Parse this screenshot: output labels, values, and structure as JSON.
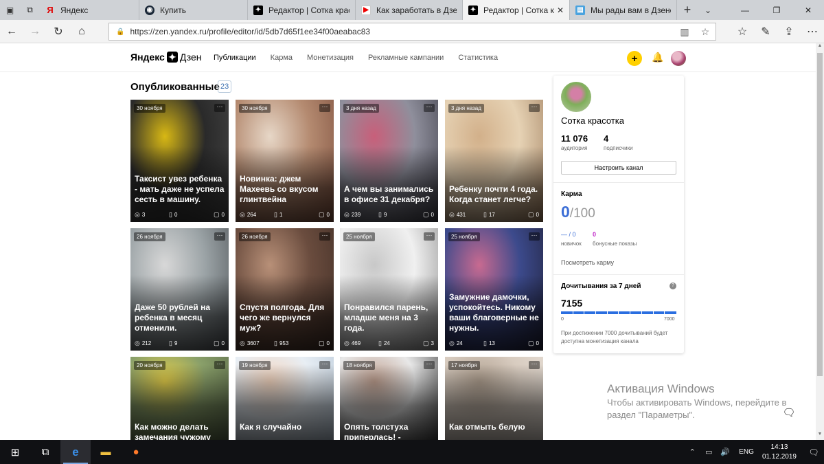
{
  "browser": {
    "tabs": [
      {
        "label": "Яндекс",
        "icon": "yandex-icon",
        "active": false
      },
      {
        "label": "Купить",
        "icon": "steam-icon",
        "active": false
      },
      {
        "label": "Редактор | Сотка красо",
        "icon": "zen-icon",
        "active": false
      },
      {
        "label": "Как заработать в Дзен",
        "icon": "video-icon",
        "active": false
      },
      {
        "label": "Редактор | Сотка к",
        "icon": "zen-icon",
        "active": true
      },
      {
        "label": "Мы рады вам в Дзене",
        "icon": "document-icon",
        "active": false
      }
    ],
    "url": "https://zen.yandex.ru/profile/editor/id/5db7d65f1ee34f00aeabac83"
  },
  "site": {
    "logo_text_1": "Яндекс",
    "logo_text_2": "Дзен",
    "nav": [
      "Публикации",
      "Карма",
      "Монетизация",
      "Рекламные кампании",
      "Статистика"
    ],
    "active_nav": "Публикации",
    "plus_label": "+"
  },
  "main": {
    "section_title": "Опубликованные",
    "count": "23",
    "cards": [
      {
        "date": "30 ноября",
        "title": "Таксист увез ребенка - мать даже не успела сесть в машину.",
        "views": "3",
        "reads": "0",
        "comments": "0",
        "colors": [
          "#2a2a2a",
          "#d8b814",
          "#4a4a4a"
        ]
      },
      {
        "date": "30 ноября",
        "title": "Новинка: джем Махеевь со вкусом глинтвейна",
        "views": "264",
        "reads": "1",
        "comments": "0",
        "colors": [
          "#b48a70",
          "#e7d7c7",
          "#7a4b3a"
        ]
      },
      {
        "date": "3 дня назад",
        "title": "А чем вы занимались в офисе 31 декабря?",
        "views": "239",
        "reads": "9",
        "comments": "0",
        "colors": [
          "#8f8f9c",
          "#c85f7a",
          "#3c3c46"
        ]
      },
      {
        "date": "3 дня назад",
        "title": "Ребенку почти 4 года. Когда станет легче?",
        "views": "431",
        "reads": "17",
        "comments": "0",
        "colors": [
          "#e6d2b4",
          "#d2b08a",
          "#9c7a5a"
        ]
      },
      {
        "date": "26 ноября",
        "title": "Даже 50 рублей на ребенка в месяц отменили.",
        "views": "212",
        "reads": "9",
        "comments": "0",
        "colors": [
          "#9ba3a6",
          "#d8d8d8",
          "#4b5054"
        ]
      },
      {
        "date": "26 ноября",
        "title": "Спустя полгода. Для чего же вернулся муж?",
        "views": "3607",
        "reads": "953",
        "comments": "0",
        "colors": [
          "#6a4c3e",
          "#b89078",
          "#3e2c24"
        ]
      },
      {
        "date": "25 ноября",
        "title": "Понравился парень, младше меня на 3 года.",
        "views": "469",
        "reads": "24",
        "comments": "3",
        "colors": [
          "#f0f0f0",
          "#c8c8c8",
          "#8a8a8a"
        ]
      },
      {
        "date": "25 ноября",
        "title": "Замужние дамочки, успокойтесь. Никому ваши благоверные не нужны.",
        "views": "24",
        "reads": "13",
        "comments": "0",
        "colors": [
          "#3c4a8c",
          "#c86a90",
          "#1e1e32"
        ]
      },
      {
        "date": "20 ноября",
        "title": "Как можно делать замечания чужому",
        "views": "",
        "reads": "",
        "comments": "",
        "colors": [
          "#8aa06a",
          "#e6d04a",
          "#5a6a4a"
        ]
      },
      {
        "date": "19 ноября",
        "title": "Как я случайно",
        "views": "",
        "reads": "",
        "comments": "",
        "colors": [
          "#e8eef4",
          "#f4d6c0",
          "#b8c8d8"
        ]
      },
      {
        "date": "18 ноября",
        "title": "Опять толстуха приперлась! - сказала",
        "views": "",
        "reads": "",
        "comments": "",
        "colors": [
          "#e8e8e8",
          "#c0a090",
          "#404040"
        ]
      },
      {
        "date": "17 ноября",
        "title": "Как отмыть белую",
        "views": "",
        "reads": "",
        "comments": "",
        "colors": [
          "#d8ccc0",
          "#b0a090",
          "#e8e0d8"
        ]
      }
    ]
  },
  "sidebar": {
    "channel_name": "Сотка красотка",
    "audience_value": "11 076",
    "audience_label": "аудитория",
    "subscribers_value": "4",
    "subscribers_label": "подписчики",
    "configure_button": "Настроить канал",
    "karma_title": "Карма",
    "karma_value": "0",
    "karma_max": "/100",
    "newbie_value": "— / 0",
    "newbie_label": "новичок",
    "bonus_value": "0",
    "bonus_label": "бонусные показы",
    "karma_link": "Посмотреть карму",
    "reads_title": "Дочитывания за 7 дней",
    "reads_value": "7155",
    "reads_progress": 1.0,
    "reads_min": "0",
    "reads_max": "7000",
    "reads_note": "При достижении 7000 дочитываний будет доступна монетизация канала"
  },
  "watermark": {
    "title": "Активация Windows",
    "line1": "Чтобы активировать Windows, перейдите в",
    "line2": "раздел \"Параметры\"."
  },
  "taskbar": {
    "lang": "ENG",
    "time": "14:13",
    "date": "01.12.2019"
  }
}
